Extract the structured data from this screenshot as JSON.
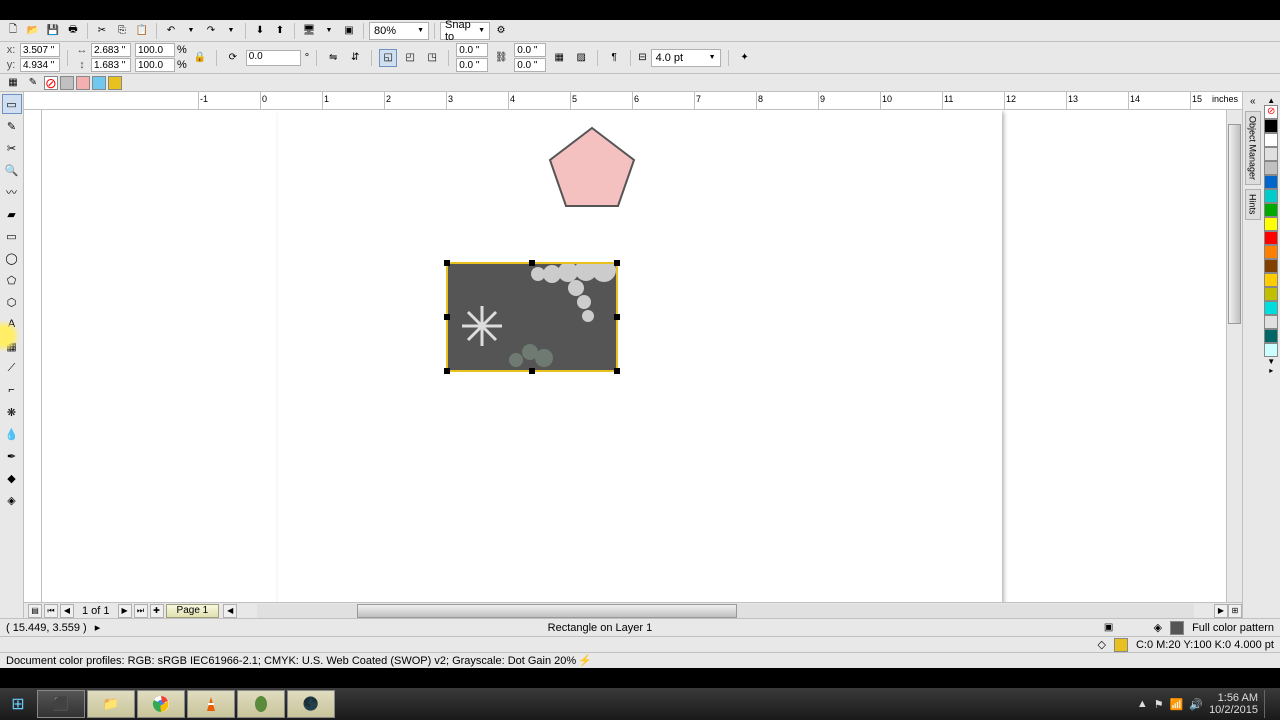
{
  "toolbar": {
    "zoom": "80%",
    "snapto": "Snap to"
  },
  "propbar": {
    "x_label": "x:",
    "x_val": "3.507 \"",
    "y_label": "y:",
    "y_val": "4.934 \"",
    "w_val": "2.683 \"",
    "h_val": "1.683 \"",
    "sx": "100.0",
    "sy": "100.0",
    "pct": "%",
    "rot": "0.0",
    "deg": "°",
    "cx": "0.0 \"",
    "cy": "0.0 \"",
    "rx": "0.0 \"",
    "ry": "0.0 \"",
    "outline": "4.0 pt"
  },
  "ruler_unit": "inches",
  "ruler_marks": {
    "vals": [
      "-1",
      "0",
      "1",
      "2",
      "3",
      "4",
      "5",
      "6",
      "7",
      "8",
      "9",
      "10",
      "11",
      "12",
      "13",
      "14",
      "15"
    ]
  },
  "page_nav": {
    "counter": "1 of 1",
    "tab": "Page 1"
  },
  "status": {
    "cursor": "( 15.449, 3.559 )",
    "object": "Rectangle on Layer 1",
    "fill_label": "Full color pattern",
    "outline_label": "C:0 M:20 Y:100 K:0  4.000 pt"
  },
  "profile": "Document color profiles: RGB: sRGB IEC61966-2.1; CMYK: U.S. Web Coated (SWOP) v2; Grayscale: Dot Gain 20% ",
  "swatches": {
    "none": "none",
    "grey": "#c0c0c0",
    "pink": "#f4b0b0",
    "cyan": "#70c8f0",
    "yellow": "#e8c020"
  },
  "palette": [
    "#000000",
    "#ffffff",
    "#e0e0e0",
    "#808080",
    "#ffff00",
    "#008000",
    "#00c0c0",
    "#ff8000",
    "#804000",
    "#c0c000",
    "#00ffff",
    "#e0e0ff",
    "#ffffff",
    "#808000"
  ],
  "docker_tabs": {
    "om": "Object Manager",
    "hints": "Hints"
  },
  "systray": {
    "time": "1:56 AM",
    "date": "10/2/2015"
  },
  "black_bars": true
}
